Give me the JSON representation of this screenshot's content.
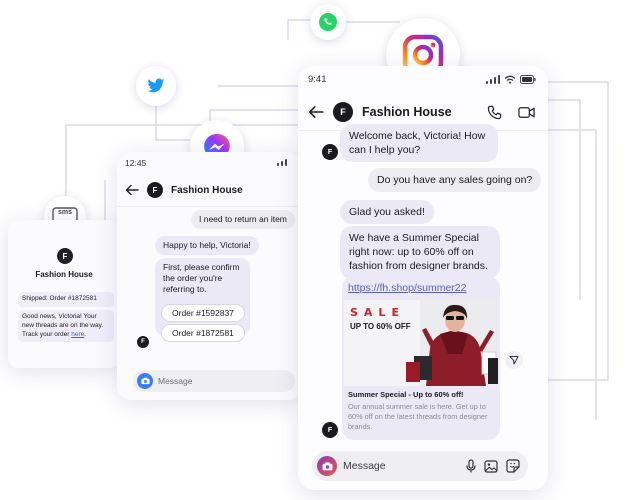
{
  "channels": {
    "sms_label": "sms"
  },
  "sms_card": {
    "logo_letter": "F",
    "brand_name": "Fashion House",
    "message_1": "Shipped: Order #1872581",
    "message_2_text": "Good news, Victoria! Your new threads are on the way. Track your order ",
    "message_2_link": "here",
    "message_2_end": "."
  },
  "messenger_card": {
    "time": "12:45",
    "logo_letter": "F",
    "title": "Fashion House",
    "outgoing_1": "I need to return an item",
    "incoming_1": "Happy to help, Victoria!",
    "incoming_2": "First, please confirm the order you're referring to.",
    "order_option_1": "Order #1592837",
    "order_option_2": "Order #1872581",
    "avatar_letter": "F",
    "input_placeholder": "Message"
  },
  "instagram_card": {
    "time": "9:41",
    "logo_letter": "F",
    "title": "Fashion House",
    "incoming_1": "Welcome back, Victoria! How can I help you?",
    "outgoing_1": "Do you have any sales going on?",
    "incoming_2": "Glad you asked!",
    "incoming_3": "We have a Summer Special right now: up to 60% off on fashion from designer brands.",
    "link": "https://fh.shop/summer22",
    "promo": {
      "sale_word": "SALE",
      "sale_sub": "UP TO 60% OFF",
      "title": "Summer Special - Up to 60% off!",
      "description": "Our annual summer sale is here. Get up to 60% off on the latest threads from designer brands."
    },
    "avatar_letter_1": "F",
    "avatar_letter_2": "F",
    "input_placeholder": "Message"
  },
  "colors": {
    "instagram_gradient": [
      "#feda75",
      "#fa7e1e",
      "#d62976",
      "#962fbf",
      "#4f5bd5"
    ],
    "messenger_gradient": [
      "#0695ff",
      "#a334fa",
      "#ff6968"
    ],
    "twitter": "#1d9bf0",
    "whatsapp": "#25d366",
    "sale_red": "#d6202a",
    "bubble": "#ebe9f6"
  },
  "icons": [
    "sms-icon",
    "twitter-icon",
    "messenger-icon",
    "whatsapp-icon",
    "instagram-icon",
    "back-arrow-icon",
    "phone-icon",
    "video-icon",
    "camera-icon",
    "microphone-icon",
    "image-icon",
    "sticker-icon",
    "share-icon"
  ]
}
